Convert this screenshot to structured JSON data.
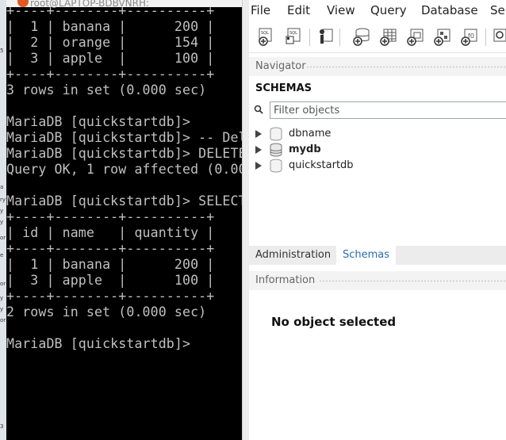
{
  "terminal": {
    "title": "root@LAPTOP-BDBVNRH:",
    "lines": [
      "+----+--------+----------+",
      "|  1 | banana |      200 |",
      "|  2 | orange |      154 |",
      "|  3 | apple  |      100 |",
      "+----+--------+----------+",
      "3 rows in set (0.000 sec)",
      "",
      "MariaDB [quickstartdb]>",
      "MariaDB [quickstartdb]> -- Del",
      "MariaDB [quickstartdb]> DELETE",
      "Query OK, 1 row affected (0.00",
      "",
      "MariaDB [quickstartdb]> SELECT",
      "+----+--------+----------+",
      "| id | name   | quantity |",
      "+----+--------+----------+",
      "|  1 | banana |      200 |",
      "|  3 | apple  |      100 |",
      "+----+--------+----------+",
      "2 rows in set (0.000 sec)",
      "",
      "MariaDB [quickstartdb]>"
    ]
  },
  "desktop_strip": {
    "glyphs": [
      "5",
      "a",
      "ry",
      "y",
      "y",
      "or",
      "e",
      "or",
      "y",
      "y",
      "or",
      "3"
    ]
  },
  "workbench": {
    "menu": [
      "File",
      "Edit",
      "View",
      "Query",
      "Database",
      "Ser"
    ],
    "toolbar_icons": [
      "new-sql-tab-icon",
      "open-sql-script-icon",
      "inspector-icon",
      "create-schema-icon",
      "create-table-icon",
      "create-view-icon",
      "create-procedure-icon",
      "create-function-icon",
      "search-table-icon"
    ],
    "navigator_label": "Navigator",
    "schemas_label": "SCHEMAS",
    "filter_placeholder": "Filter objects",
    "schemas": [
      {
        "name": "dbname",
        "bold": false
      },
      {
        "name": "mydb",
        "bold": true
      },
      {
        "name": "quickstartdb",
        "bold": false
      }
    ],
    "tabs": {
      "administration": "Administration",
      "schemas": "Schemas"
    },
    "information_label": "Information",
    "no_object_text": "No object selected"
  },
  "colors": {
    "terminal_bg": "#000000",
    "terminal_fg": "#c0c0c0",
    "accent": "#2b6cb0"
  }
}
